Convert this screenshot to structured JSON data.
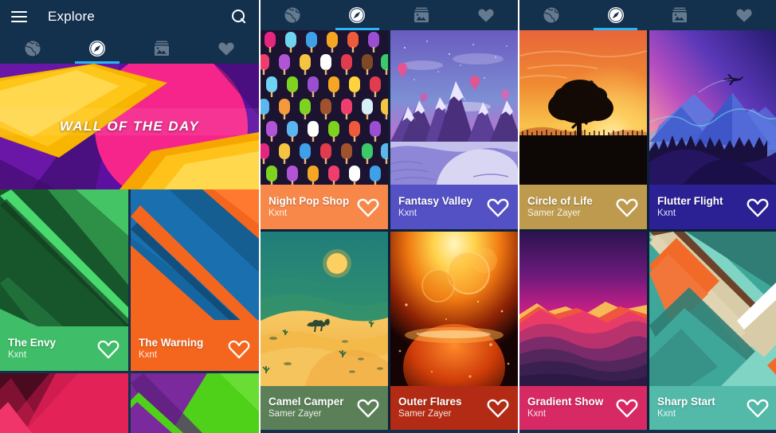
{
  "app": {
    "title": "Explore",
    "menu_icon": "hamburger-menu-icon",
    "search_icon": "search-icon",
    "accent_color": "#29b6f6",
    "appbar_color": "#13304d"
  },
  "tabs": [
    {
      "id": "globe",
      "icon": "globe-icon",
      "label": "Globe",
      "active": false
    },
    {
      "id": "explore",
      "icon": "compass-icon",
      "label": "Explore",
      "active": true
    },
    {
      "id": "gallery",
      "icon": "image-stack-icon",
      "label": "Gallery",
      "active": false
    },
    {
      "id": "favs",
      "icon": "heart-icon",
      "label": "Favorites",
      "active": false
    }
  ],
  "featured": {
    "label": "WALL OF THE DAY"
  },
  "panel1": {
    "cards": [
      {
        "title": "The Envy",
        "author": "Kxnt",
        "bg": "#3fbd68",
        "fav_icon": "heart-outline-icon"
      },
      {
        "title": "The Warning",
        "author": "Kxnt",
        "bg": "#f4661e",
        "fav_icon": "heart-outline-icon"
      }
    ]
  },
  "panel2": {
    "cards": [
      {
        "title": "Night Pop Shop",
        "author": "Kxnt",
        "bg": "#f7884a",
        "art": "popsicles",
        "fav_icon": "heart-outline-icon"
      },
      {
        "title": "Fantasy Valley",
        "author": "Kxnt",
        "bg": "#5451c4",
        "art": "valley",
        "fav_icon": "heart-outline-icon"
      },
      {
        "title": "Camel Camper",
        "author": "Samer Zayer",
        "bg": "#5b8057",
        "art": "desert",
        "fav_icon": "heart-outline-icon"
      },
      {
        "title": "Outer Flares",
        "author": "Samer Zayer",
        "bg": "#b32b14",
        "art": "flare",
        "fav_icon": "heart-outline-icon"
      }
    ]
  },
  "panel3": {
    "cards": [
      {
        "title": "Circle of Life",
        "author": "Samer Zayer",
        "bg": "#bd9a4e",
        "art": "tree",
        "fav_icon": "heart-outline-icon"
      },
      {
        "title": "Flutter Flight",
        "author": "Kxnt",
        "bg": "#2b2094",
        "art": "flutter",
        "fav_icon": "heart-outline-icon"
      },
      {
        "title": "Gradient Show",
        "author": "Kxnt",
        "bg": "#d72963",
        "art": "gradient",
        "fav_icon": "heart-outline-icon"
      },
      {
        "title": "Sharp Start",
        "author": "Kxnt",
        "bg": "#53b9a8",
        "art": "sharp",
        "fav_icon": "heart-outline-icon"
      }
    ]
  }
}
